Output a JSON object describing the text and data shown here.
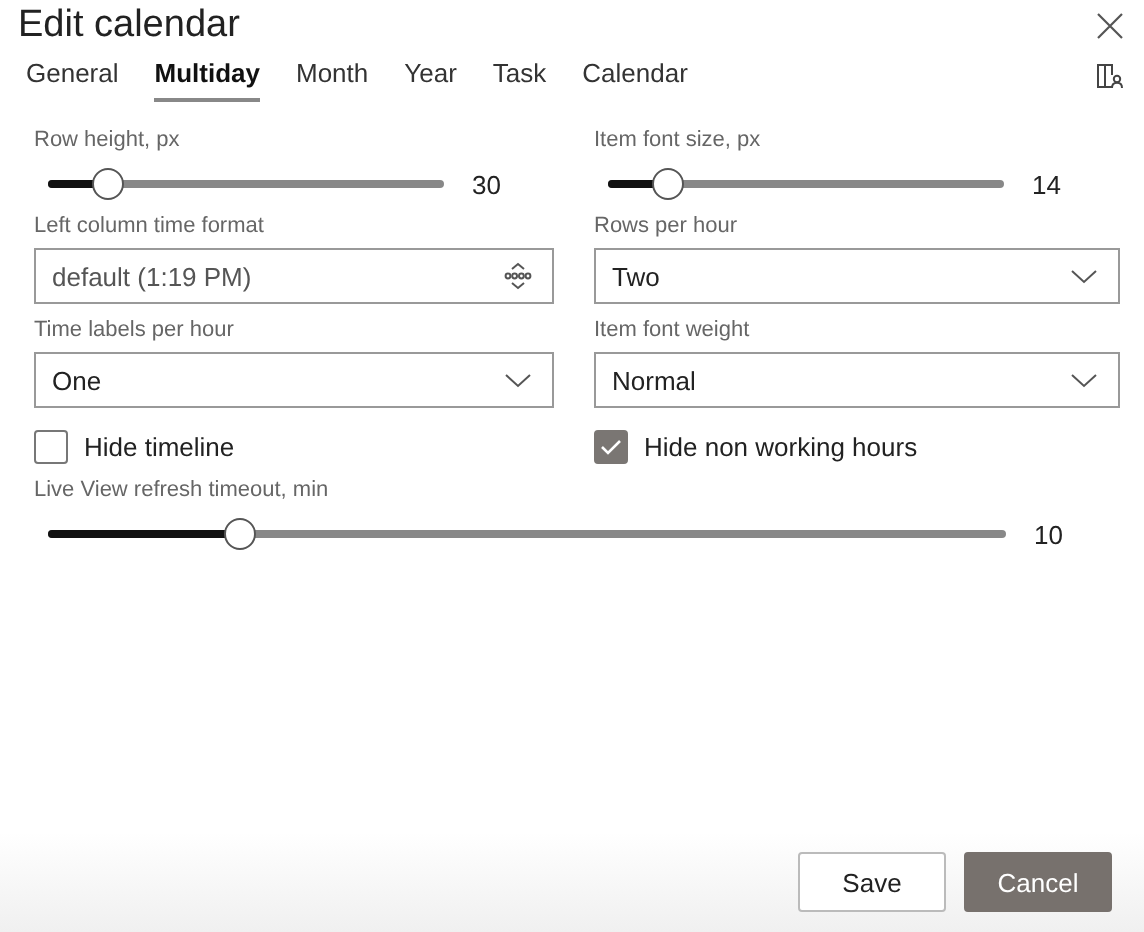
{
  "window": {
    "title": "Edit calendar"
  },
  "tabs": [
    {
      "label": "General",
      "selected": false
    },
    {
      "label": "Multiday",
      "selected": true
    },
    {
      "label": "Month",
      "selected": false
    },
    {
      "label": "Year",
      "selected": false
    },
    {
      "label": "Task",
      "selected": false
    },
    {
      "label": "Calendar",
      "selected": false
    }
  ],
  "fields": [
    {
      "kind": "slider",
      "label": "Row height, px",
      "level": 0.15,
      "reading": "30"
    },
    {
      "kind": "slider",
      "label": "Item font size, px",
      "level": 0.15,
      "reading": "14"
    },
    {
      "kind": "spinner",
      "label": "Left column time format",
      "value": "default (1:19 PM)"
    },
    {
      "kind": "dropdown",
      "label": "Rows per hour",
      "value": "Two"
    },
    {
      "kind": "dropdown",
      "label": "Time labels per hour",
      "value": "One"
    },
    {
      "kind": "dropdown",
      "label": "Item font weight",
      "value": "Normal"
    },
    {
      "kind": "checkbox",
      "label": "Hide timeline",
      "checked": false
    },
    {
      "kind": "checkbox",
      "label": "Hide non working hours",
      "checked": true
    },
    {
      "kind": "wide-slider",
      "label": "Live View refresh timeout, min",
      "level": 0.2,
      "reading": "10"
    }
  ],
  "buttons": [
    {
      "label": "Save",
      "kind": "secondary"
    },
    {
      "label": "Cancel",
      "kind": "primary"
    }
  ]
}
